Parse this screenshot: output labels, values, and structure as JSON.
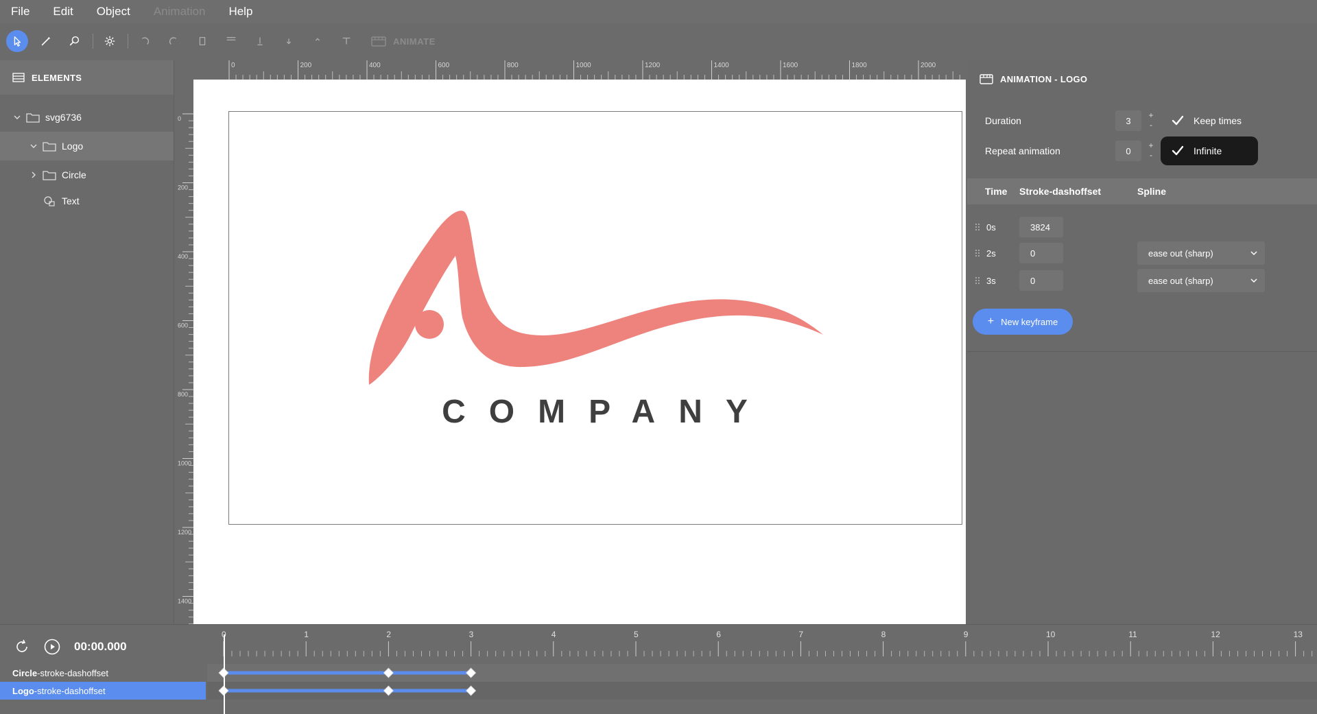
{
  "menu": {
    "items": [
      {
        "label": "File",
        "disabled": false
      },
      {
        "label": "Edit",
        "disabled": false
      },
      {
        "label": "Object",
        "disabled": false
      },
      {
        "label": "Animation",
        "disabled": true
      },
      {
        "label": "Help",
        "disabled": false
      }
    ]
  },
  "toolbar": {
    "animate_label": "ANIMATE"
  },
  "elements_panel": {
    "title": "ELEMENTS",
    "tree": [
      {
        "label": "svg6736",
        "indent": 0,
        "chevron": "down",
        "icon": "folder-icon"
      },
      {
        "label": "Logo",
        "indent": 1,
        "chevron": "down",
        "icon": "folder-icon",
        "selected": true
      },
      {
        "label": "Circle",
        "indent": 1,
        "chevron": "right",
        "icon": "folder-icon"
      },
      {
        "label": "Text",
        "indent": 1,
        "chevron": "none",
        "icon": "text-shape-icon"
      }
    ]
  },
  "ruler": {
    "h_labels": [
      "0",
      "200",
      "400",
      "600",
      "800",
      "1000",
      "1200",
      "1400",
      "1600",
      "1800",
      "2000"
    ],
    "v_labels": [
      "0",
      "200",
      "400",
      "600",
      "800",
      "1000",
      "1200",
      "1400"
    ]
  },
  "canvas": {
    "logo_text": "COMPANY",
    "logo_color": "#ee827c",
    "text_color": "#3f3f3f"
  },
  "animation_panel": {
    "title": "ANIMATION - LOGO",
    "duration_label": "Duration",
    "duration_value": "3",
    "keep_times_label": "Keep times",
    "repeat_label": "Repeat animation",
    "repeat_value": "0",
    "infinite_label": "Infinite",
    "stepper_plus": "+",
    "stepper_minus": "-",
    "table_headers": {
      "time": "Time",
      "property": "Stroke-dashoffset",
      "spline": "Spline"
    },
    "keyframes": [
      {
        "time": "0s",
        "value": "3824",
        "spline": ""
      },
      {
        "time": "2s",
        "value": "0",
        "spline": "ease out (sharp)"
      },
      {
        "time": "3s",
        "value": "0",
        "spline": "ease out (sharp)"
      }
    ],
    "new_keyframe_label": "New keyframe",
    "accent": "#5b8dee"
  },
  "timeline": {
    "current_time": "00:00.000",
    "scale_labels": [
      "0",
      "1",
      "2",
      "3",
      "4",
      "5",
      "6",
      "7",
      "8",
      "9",
      "10",
      "11",
      "12",
      "13"
    ],
    "tracks": [
      {
        "name_bold": "Circle",
        "name_rest": "-stroke-dashoffset",
        "selected": false,
        "keyframes": [
          0,
          2,
          3
        ]
      },
      {
        "name_bold": "Logo",
        "name_rest": "-stroke-dashoffset",
        "selected": true,
        "keyframes": [
          0,
          2,
          3
        ]
      }
    ]
  }
}
